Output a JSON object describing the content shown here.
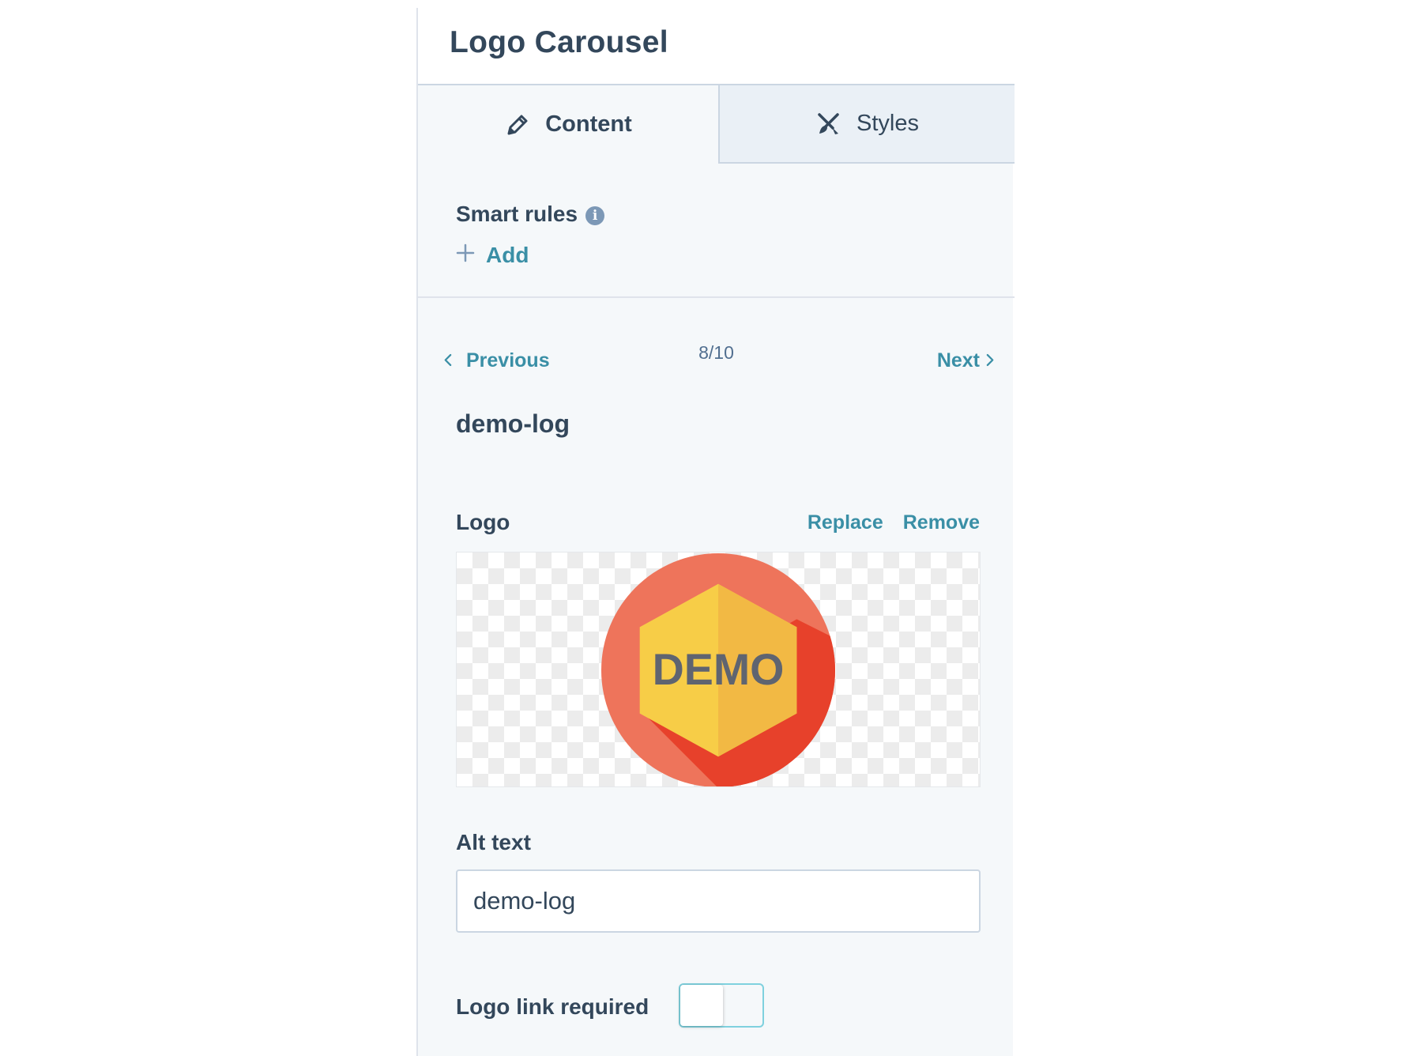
{
  "header": {
    "title": "Logo Carousel"
  },
  "tabs": [
    {
      "label": "Content",
      "icon": "pencil-icon",
      "active": true
    },
    {
      "label": "Styles",
      "icon": "brush-pencil-crossed-icon",
      "active": false
    }
  ],
  "smart_rules": {
    "label": "Smart rules",
    "info_icon": "info-icon",
    "add_label": "Add"
  },
  "navigation": {
    "previous_label": "Previous",
    "next_label": "Next",
    "pager": "8/10"
  },
  "item": {
    "name": "demo-log",
    "logo_label": "Logo",
    "replace_label": "Replace",
    "remove_label": "Remove",
    "logo_text": "DEMO",
    "alt_text_label": "Alt text",
    "alt_text_value": "demo-log",
    "link_required_label": "Logo link required",
    "link_required_on": false
  },
  "colors": {
    "accent": "#3a8fa6",
    "text": "#33475b",
    "logo_circle": "#ee745b",
    "logo_circle_shadow": "#e7412b",
    "logo_hex_left": "#f7cd47",
    "logo_hex_right": "#f2b944",
    "logo_text": "#5f6470"
  }
}
